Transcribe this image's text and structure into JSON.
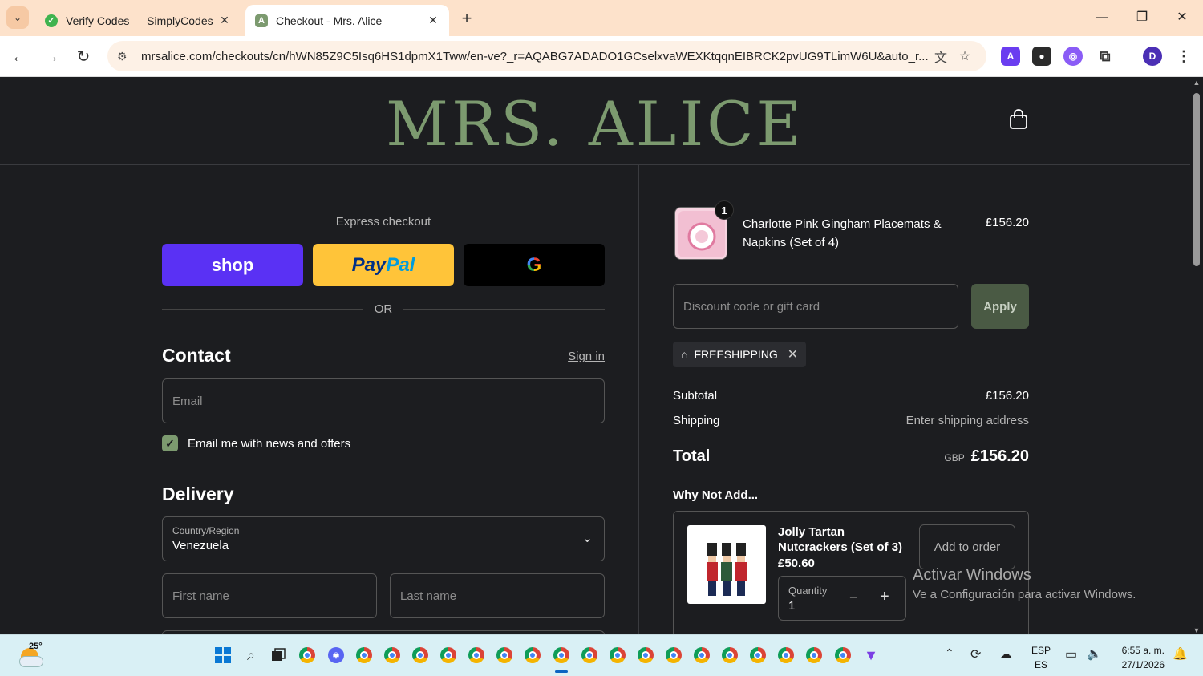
{
  "browser": {
    "tabs": [
      {
        "title": "Verify Codes — SimplyCodes",
        "active": false
      },
      {
        "title": "Checkout - Mrs. Alice",
        "active": true
      }
    ],
    "url": "mrsalice.com/checkouts/cn/hWN85Z9C5Isq6HS1dpmX1Tww/en-ve?_r=AQABG7ADADO1GCselxvaWEXKtqqnEIBRCK2pvUG9TLimW6U&auto_r...",
    "profile_initial": "D"
  },
  "store": {
    "logo": "MRS. ALICE"
  },
  "express": {
    "title": "Express checkout",
    "shop_label": "shop",
    "paypal_label_1": "Pay",
    "paypal_label_2": "Pal",
    "gpay_label": "G",
    "or_label": "OR"
  },
  "contact": {
    "heading": "Contact",
    "signin_label": "Sign in",
    "email_placeholder": "Email",
    "newsletter_label": "Email me with news and offers",
    "newsletter_checked": true
  },
  "delivery": {
    "heading": "Delivery",
    "country_label": "Country/Region",
    "country_value": "Venezuela",
    "first_name_placeholder": "First name",
    "last_name_placeholder": "Last name"
  },
  "cart": {
    "item_name": "Charlotte Pink Gingham Placemats & Napkins (Set of 4)",
    "item_price": "£156.20",
    "item_qty": "1",
    "discount_placeholder": "Discount code or gift card",
    "apply_label": "Apply",
    "applied_code": "FREESHIPPING",
    "subtotal_label": "Subtotal",
    "subtotal_value": "£156.20",
    "shipping_label": "Shipping",
    "shipping_value": "Enter shipping address",
    "total_label": "Total",
    "total_currency": "GBP",
    "total_value": "£156.20"
  },
  "upsell": {
    "heading": "Why Not Add...",
    "name": "Jolly Tartan Nutcrackers (Set of 3)",
    "price": "£50.60",
    "add_label": "Add to order",
    "qty_label": "Quantity",
    "qty_value": "1"
  },
  "watermark": {
    "line1": "Activar Windows",
    "line2": "Ve a Configuración para activar Windows."
  },
  "taskbar": {
    "temperature": "25°",
    "lang_1": "ESP",
    "lang_2": "ES",
    "time": "6:55 a. m.",
    "date": "27/1/2026"
  },
  "colors": {
    "brand_green": "#7c9a6f",
    "shop_purple": "#5a31f4",
    "paypal_yellow": "#ffc439",
    "page_bg": "#1c1d20"
  }
}
